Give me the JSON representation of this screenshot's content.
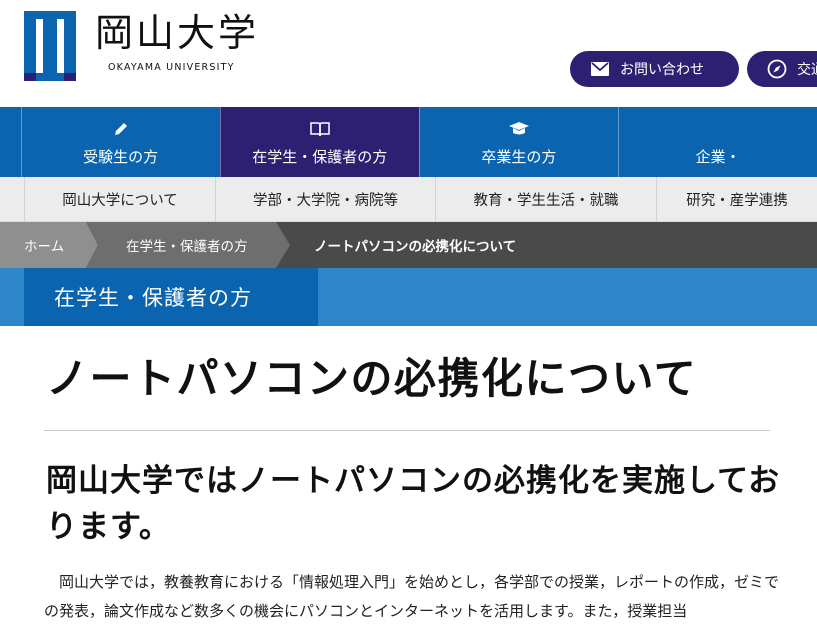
{
  "header": {
    "logo_jp": "岡山大学",
    "logo_en": "OKAYAMA UNIVERSITY",
    "contact_label": "お問い合わせ",
    "access_label": "交通",
    "accent_color": "#2d2073",
    "logo_blue": "#0b64b0"
  },
  "primary_nav": {
    "items": [
      {
        "label": "受験生の方",
        "icon": "pencil-icon"
      },
      {
        "label": "在学生・保護者の方",
        "icon": "book-icon"
      },
      {
        "label": "卒業生の方",
        "icon": "graduation-cap-icon"
      },
      {
        "label": "企業・",
        "icon": "building-icon"
      }
    ]
  },
  "secondary_nav": {
    "items": [
      {
        "label": "岡山大学について"
      },
      {
        "label": "学部・大学院・病院等"
      },
      {
        "label": "教育・学生生活・就職"
      },
      {
        "label": "研究・産学連携"
      }
    ]
  },
  "breadcrumb": {
    "items": [
      {
        "label": "ホーム"
      },
      {
        "label": "在学生・保護者の方"
      },
      {
        "label": "ノートパソコンの必携化について"
      }
    ]
  },
  "section": {
    "label": "在学生・保護者の方"
  },
  "content": {
    "title": "ノートパソコンの必携化について",
    "subtitle": "岡山大学ではノートパソコンの必携化を実施しております。",
    "body": "岡山大学では，教養教育における「情報処理入門」を始めとし，各学部での授業，レポートの作成，ゼミでの発表，論文作成など数多くの機会にパソコンとインターネットを活用します。また，授業担当"
  }
}
